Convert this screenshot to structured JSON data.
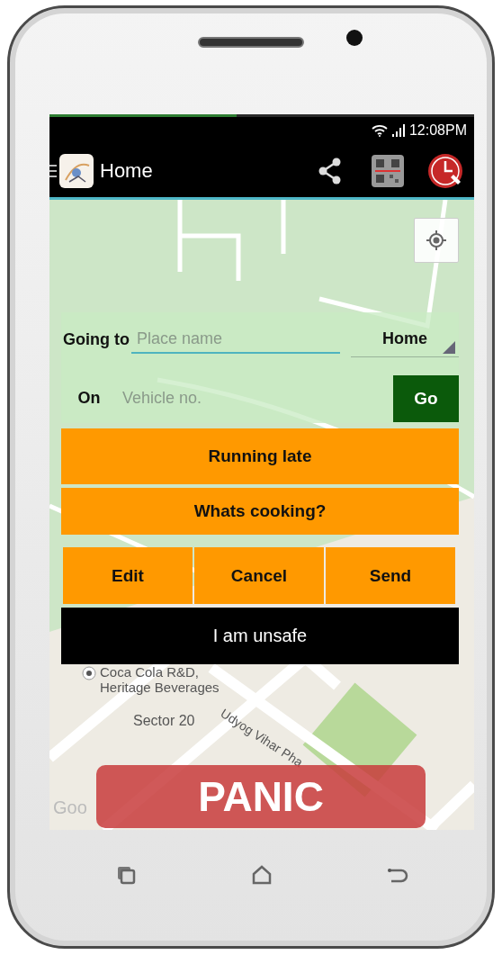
{
  "status_bar": {
    "time": "12:08PM"
  },
  "app_bar": {
    "title": "Home"
  },
  "trip_form": {
    "destination_label": "Going to",
    "destination_placeholder": "Place name",
    "saved_place": "Home",
    "vehicle_label": "On",
    "vehicle_placeholder": "Vehicle no.",
    "go_button": "Go"
  },
  "quick_messages": [
    "Running late",
    "Whats cooking?"
  ],
  "message_actions": [
    "Edit",
    "Cancel",
    "Send"
  ],
  "unsafe_button": "I am unsafe",
  "map": {
    "place": [
      "Coca Cola R&D,",
      "Heritage Beverages"
    ],
    "area": "Sector 20",
    "road": "Udyog Vihar Pha",
    "attribution": "Goo"
  },
  "panic_button": "PANIC"
}
